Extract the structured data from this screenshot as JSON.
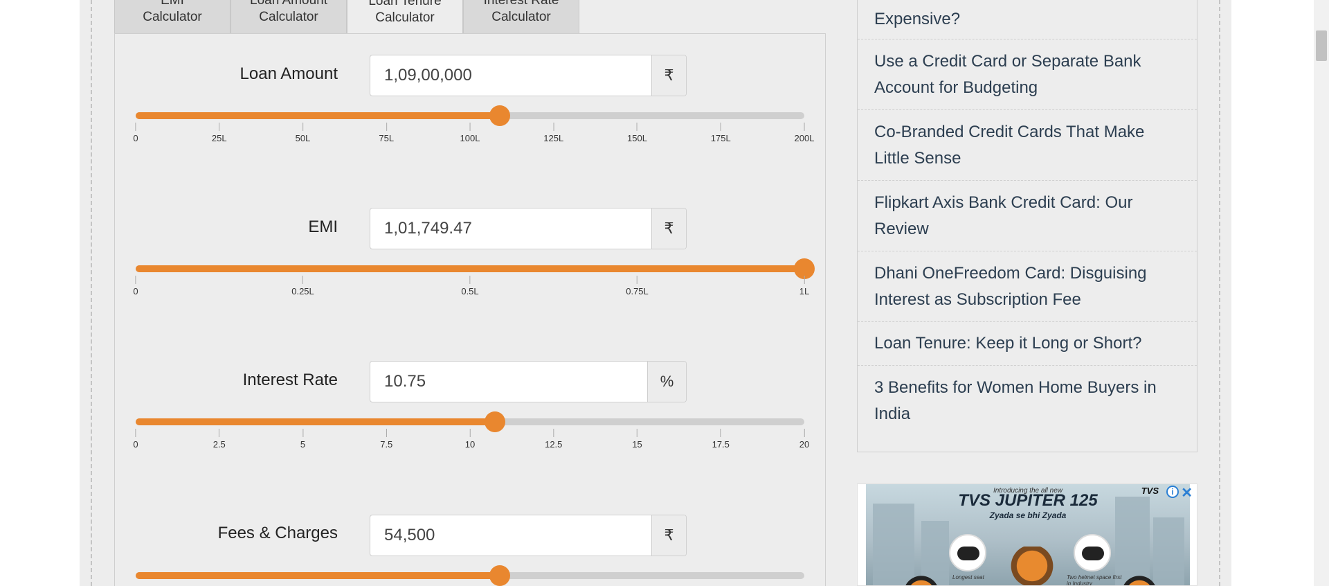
{
  "tabs": [
    {
      "label": "EMI Calculator",
      "line1": "EMI",
      "line2": "Calculator",
      "active": false
    },
    {
      "label": "Loan Amount Calculator",
      "line1": "Loan Amount",
      "line2": "Calculator",
      "active": false
    },
    {
      "label": "Loan Tenure Calculator",
      "line1": "Loan Tenure",
      "line2": "Calculator",
      "active": true
    },
    {
      "label": "Interest Rate Calculator",
      "line1": "Interest Rate",
      "line2": "Calculator",
      "active": false
    }
  ],
  "calculator": {
    "loan_amount": {
      "label": "Loan Amount",
      "value": "1,09,00,000",
      "unit": "₹",
      "slider_fraction": 0.545,
      "ticks": [
        "0",
        "25L",
        "50L",
        "75L",
        "100L",
        "125L",
        "150L",
        "175L",
        "200L"
      ]
    },
    "emi": {
      "label": "EMI",
      "value": "1,01,749.47",
      "unit": "₹",
      "slider_fraction": 1.0,
      "ticks": [
        "0",
        "0.25L",
        "0.5L",
        "0.75L",
        "1L"
      ]
    },
    "interest_rate": {
      "label": "Interest Rate",
      "value": "10.75",
      "unit": "%",
      "slider_fraction": 0.5375,
      "ticks": [
        "0",
        "2.5",
        "5",
        "7.5",
        "10",
        "12.5",
        "15",
        "17.5",
        "20"
      ]
    },
    "fees": {
      "label": "Fees & Charges",
      "value": "54,500",
      "unit": "₹",
      "slider_fraction": 0.545
    }
  },
  "sidebar": {
    "items": [
      "Expensive?",
      "Use a Credit Card or Separate Bank Account for Budgeting",
      "Co-Branded Credit Cards That Make Little Sense",
      "Flipkart Axis Bank Credit Card: Our Review",
      "Dhani OneFreedom Card: Disguising Interest as Subscription Fee",
      "Loan Tenure: Keep it Long or Short?",
      "3 Benefits for Women Home Buyers in India"
    ]
  },
  "ad": {
    "intro": "Introducing the all new",
    "title": "TVS JUPITER 125",
    "tagline": "Zyada se bhi Zyada",
    "brand": "TVS",
    "info_glyph": "i",
    "close_glyph": "✕",
    "caption_seat": "Longest seat",
    "caption_helmet": "Two helmet space first in Industry"
  },
  "colors": {
    "accent": "#e9872f",
    "track": "#cfcfcf",
    "panel_bg": "#ededed"
  }
}
